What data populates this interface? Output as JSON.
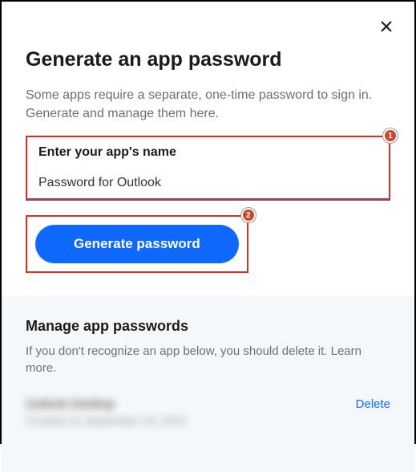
{
  "header": {
    "title": "Generate an app password",
    "description": "Some apps require a separate, one-time password to sign in. Generate and manage them here."
  },
  "form": {
    "label": "Enter your app's name",
    "value": "Password for Outlook",
    "button_label": "Generate password"
  },
  "callouts": {
    "one": "1",
    "two": "2"
  },
  "manage": {
    "title": "Manage app passwords",
    "description_prefix": "If you don't recognize an app below, you should delete it. ",
    "learn_more": "Learn more.",
    "apps": [
      {
        "name": "Outlook Desktop",
        "created": "Created on September 19, 2022",
        "delete_label": "Delete"
      }
    ]
  }
}
